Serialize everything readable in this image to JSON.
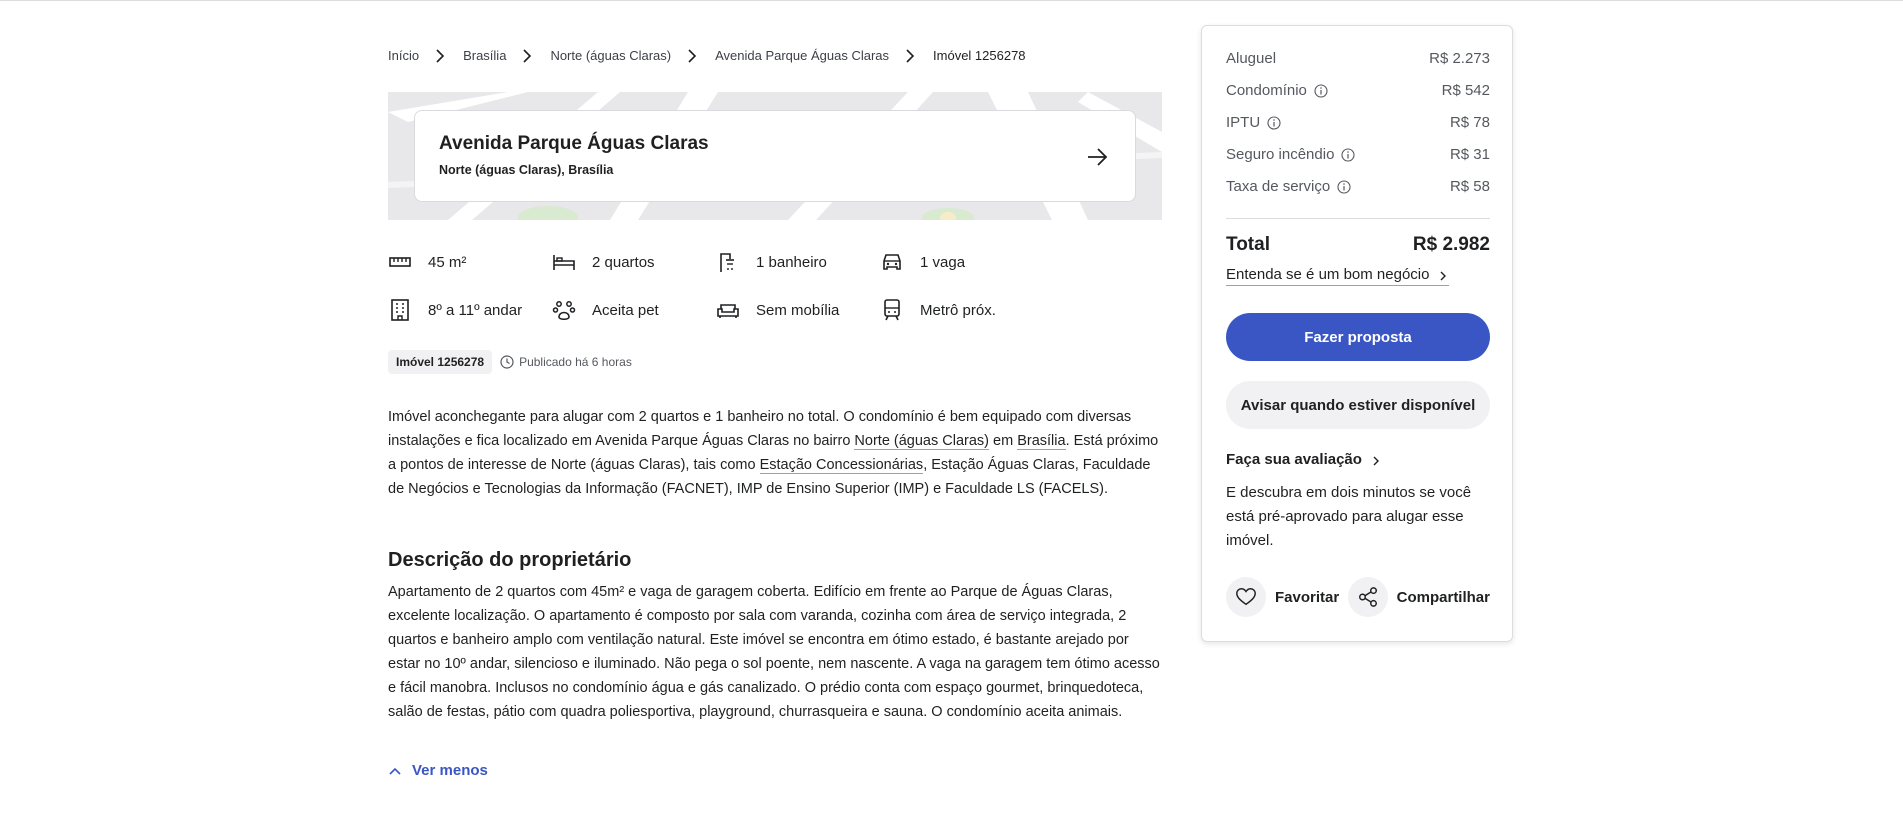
{
  "breadcrumb": {
    "items": [
      "Início",
      "Brasília",
      "Norte (águas Claras)",
      "Avenida Parque Águas Claras",
      "Imóvel 1256278"
    ]
  },
  "address": {
    "title": "Avenida Parque Águas Claras",
    "subtitle": "Norte (águas Claras), Brasília"
  },
  "features": {
    "area": "45 m²",
    "bedrooms": "2 quartos",
    "bathrooms": "1 banheiro",
    "parking": "1 vaga",
    "floor": "8º a 11º andar",
    "pets": "Aceita pet",
    "furniture": "Sem mobília",
    "metro": "Metrô próx."
  },
  "meta": {
    "code": "Imóvel 1256278",
    "published": "Publicado há 6 horas"
  },
  "description": {
    "p1": "Imóvel aconchegante para alugar com 2 quartos e 1 banheiro no total. O condomínio é bem equipado com diversas instalações e fica localizado em Avenida Parque Águas Claras no bairro ",
    "link_neighborhood": "Norte (águas Claras)",
    "p2": " em ",
    "link_city": "Brasília",
    "p3": ". Está próximo a pontos de interesse de Norte (águas Claras), tais como ",
    "link_poi": "Estação Concessionárias",
    "p4": ", Estação Águas Claras, Faculdade de Negócios e Tecnologias da Informação (FACNET), IMP de Ensino Superior (IMP) e Faculdade LS (FACELS)."
  },
  "owner": {
    "title": "Descrição do proprietário",
    "text": "Apartamento de 2 quartos com 45m² e vaga de garagem coberta. Edifício em frente ao Parque de Águas Claras, excelente localização. O apartamento é composto por sala com varanda, cozinha com área de serviço integrada, 2 quartos e banheiro amplo com ventilação natural. Este imóvel se encontra em ótimo estado, é bastante arejado por estar no 10º andar, silencioso e iluminado. Não pega o sol poente, nem nascente. A vaga na garagem tem ótimo acesso e fácil manobra. Inclusos no condomínio água e gás canalizado. O prédio conta com espaço gourmet, brinquedoteca, salão de festas, pátio com quadra poliesportiva, playground, churrasqueira e sauna. O condomínio aceita animais.",
    "less_label": "Ver menos"
  },
  "costs": {
    "rent_label": "Aluguel",
    "rent": "R$ 2.273",
    "condo_label": "Condomínio",
    "condo": "R$ 542",
    "iptu_label": "IPTU",
    "iptu": "R$ 78",
    "insurance_label": "Seguro incêndio",
    "insurance": "R$ 31",
    "fee_label": "Taxa de serviço",
    "fee": "R$ 58",
    "total_label": "Total",
    "total": "R$ 2.982",
    "understand": "Entenda se é um bom negócio"
  },
  "actions": {
    "propose": "Fazer proposta",
    "notify": "Avisar quando estiver disponível",
    "rate_title": "Faça sua avaliação",
    "rate_text": "E descubra em dois minutos se você está pré-aprovado para alugar esse imóvel.",
    "favorite": "Favoritar",
    "share": "Compartilhar"
  },
  "colors": {
    "accent": "#3a56c5",
    "text": "#1f2022",
    "muted": "#55585e"
  }
}
